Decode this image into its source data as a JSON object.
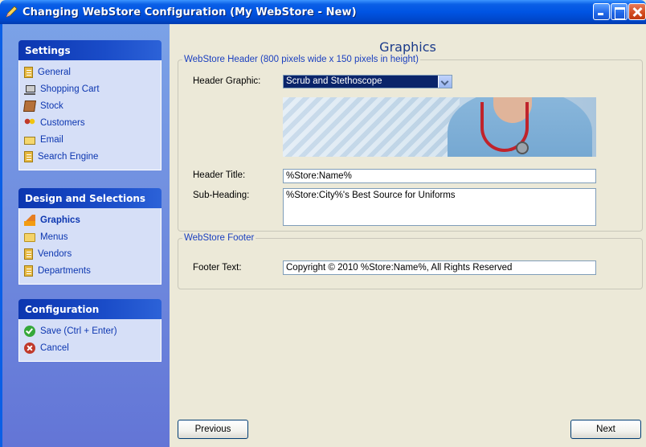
{
  "window": {
    "title": "Changing WebStore Configuration  (My WebStore - New)"
  },
  "sidebar": {
    "settings": {
      "heading": "Settings",
      "items": [
        {
          "label": "General",
          "icon": "document-icon"
        },
        {
          "label": "Shopping Cart",
          "icon": "cart-icon"
        },
        {
          "label": "Stock",
          "icon": "box-icon"
        },
        {
          "label": "Customers",
          "icon": "people-icon"
        },
        {
          "label": "Email",
          "icon": "email-icon"
        },
        {
          "label": "Search Engine",
          "icon": "document-icon"
        }
      ]
    },
    "design": {
      "heading": "Design and Selections",
      "items": [
        {
          "label": "Graphics",
          "icon": "graphics-icon",
          "active": true
        },
        {
          "label": "Menus",
          "icon": "folder-icon"
        },
        {
          "label": "Vendors",
          "icon": "document-icon"
        },
        {
          "label": "Departments",
          "icon": "document-icon"
        }
      ]
    },
    "configuration": {
      "heading": "Configuration",
      "items": [
        {
          "label": "Save (Ctrl + Enter)",
          "icon": "check-icon"
        },
        {
          "label": "Cancel",
          "icon": "cancel-icon"
        }
      ]
    }
  },
  "main": {
    "title": "Graphics",
    "header_group": {
      "legend": "WebStore Header  (800 pixels wide x 150 pixels in height)",
      "graphic_label": "Header Graphic:",
      "graphic_value": "Scrub and Stethoscope",
      "title_label": "Header Title:",
      "title_value": "%Store:Name%",
      "subheading_label": "Sub-Heading:",
      "subheading_value": "%Store:City%'s Best Source for Uniforms"
    },
    "footer_group": {
      "legend": "WebStore Footer",
      "text_label": "Footer Text:",
      "text_value": "Copyright © 2010 %Store:Name%, All Rights Reserved"
    }
  },
  "buttons": {
    "previous": "Previous",
    "next": "Next"
  }
}
